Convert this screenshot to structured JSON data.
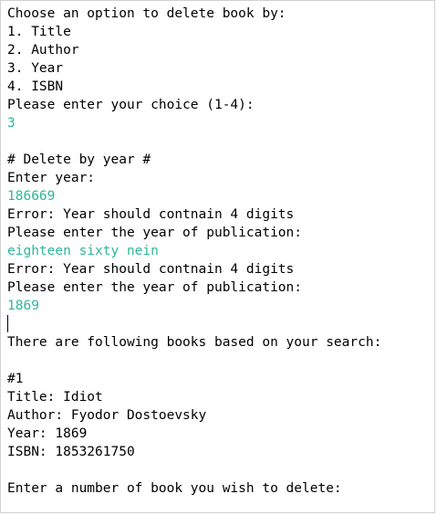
{
  "console": {
    "lines": [
      {
        "text": "Choose an option to delete book by:",
        "kind": "output"
      },
      {
        "text": "1. Title",
        "kind": "output"
      },
      {
        "text": "2. Author",
        "kind": "output"
      },
      {
        "text": "3. Year",
        "kind": "output"
      },
      {
        "text": "4. ISBN",
        "kind": "output"
      },
      {
        "text": "Please enter your choice (1-4):",
        "kind": "output"
      },
      {
        "text": "3",
        "kind": "input"
      },
      {
        "text": "",
        "kind": "blank"
      },
      {
        "text": "# Delete by year #",
        "kind": "output"
      },
      {
        "text": "Enter year:",
        "kind": "output"
      },
      {
        "text": "186669",
        "kind": "input"
      },
      {
        "text": "Error: Year should contnain 4 digits",
        "kind": "output"
      },
      {
        "text": "Please enter the year of publication:",
        "kind": "output"
      },
      {
        "text": "eighteen sixty nein",
        "kind": "input"
      },
      {
        "text": "Error: Year should contnain 4 digits",
        "kind": "output"
      },
      {
        "text": "Please enter the year of publication:",
        "kind": "output"
      },
      {
        "text": "1869",
        "kind": "input"
      },
      {
        "text": "",
        "kind": "caret"
      },
      {
        "text": "There are following books based on your search:",
        "kind": "output"
      },
      {
        "text": "",
        "kind": "blank"
      },
      {
        "text": "#1",
        "kind": "output"
      },
      {
        "text": "Title: Idiot",
        "kind": "output"
      },
      {
        "text": "Author: Fyodor Dostoevsky",
        "kind": "output"
      },
      {
        "text": "Year: 1869",
        "kind": "output"
      },
      {
        "text": "ISBN: 1853261750",
        "kind": "output"
      },
      {
        "text": "",
        "kind": "blank"
      },
      {
        "text": "Enter a number of book you wish to delete:",
        "kind": "output"
      }
    ],
    "colors": {
      "output": "#000000",
      "input": "#2eb59a",
      "background": "#ffffff"
    }
  }
}
